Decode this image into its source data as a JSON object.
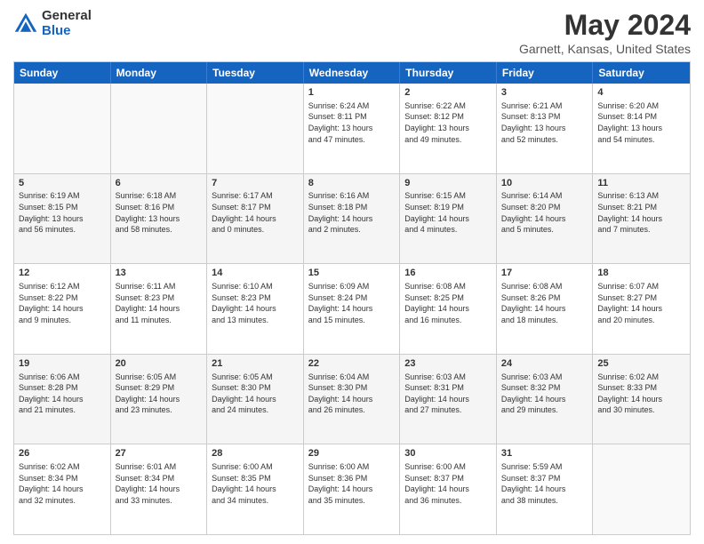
{
  "logo": {
    "general": "General",
    "blue": "Blue"
  },
  "title": "May 2024",
  "subtitle": "Garnett, Kansas, United States",
  "calendar": {
    "headers": [
      "Sunday",
      "Monday",
      "Tuesday",
      "Wednesday",
      "Thursday",
      "Friday",
      "Saturday"
    ],
    "rows": [
      [
        {
          "day": "",
          "text": ""
        },
        {
          "day": "",
          "text": ""
        },
        {
          "day": "",
          "text": ""
        },
        {
          "day": "1",
          "text": "Sunrise: 6:24 AM\nSunset: 8:11 PM\nDaylight: 13 hours\nand 47 minutes."
        },
        {
          "day": "2",
          "text": "Sunrise: 6:22 AM\nSunset: 8:12 PM\nDaylight: 13 hours\nand 49 minutes."
        },
        {
          "day": "3",
          "text": "Sunrise: 6:21 AM\nSunset: 8:13 PM\nDaylight: 13 hours\nand 52 minutes."
        },
        {
          "day": "4",
          "text": "Sunrise: 6:20 AM\nSunset: 8:14 PM\nDaylight: 13 hours\nand 54 minutes."
        }
      ],
      [
        {
          "day": "5",
          "text": "Sunrise: 6:19 AM\nSunset: 8:15 PM\nDaylight: 13 hours\nand 56 minutes."
        },
        {
          "day": "6",
          "text": "Sunrise: 6:18 AM\nSunset: 8:16 PM\nDaylight: 13 hours\nand 58 minutes."
        },
        {
          "day": "7",
          "text": "Sunrise: 6:17 AM\nSunset: 8:17 PM\nDaylight: 14 hours\nand 0 minutes."
        },
        {
          "day": "8",
          "text": "Sunrise: 6:16 AM\nSunset: 8:18 PM\nDaylight: 14 hours\nand 2 minutes."
        },
        {
          "day": "9",
          "text": "Sunrise: 6:15 AM\nSunset: 8:19 PM\nDaylight: 14 hours\nand 4 minutes."
        },
        {
          "day": "10",
          "text": "Sunrise: 6:14 AM\nSunset: 8:20 PM\nDaylight: 14 hours\nand 5 minutes."
        },
        {
          "day": "11",
          "text": "Sunrise: 6:13 AM\nSunset: 8:21 PM\nDaylight: 14 hours\nand 7 minutes."
        }
      ],
      [
        {
          "day": "12",
          "text": "Sunrise: 6:12 AM\nSunset: 8:22 PM\nDaylight: 14 hours\nand 9 minutes."
        },
        {
          "day": "13",
          "text": "Sunrise: 6:11 AM\nSunset: 8:23 PM\nDaylight: 14 hours\nand 11 minutes."
        },
        {
          "day": "14",
          "text": "Sunrise: 6:10 AM\nSunset: 8:23 PM\nDaylight: 14 hours\nand 13 minutes."
        },
        {
          "day": "15",
          "text": "Sunrise: 6:09 AM\nSunset: 8:24 PM\nDaylight: 14 hours\nand 15 minutes."
        },
        {
          "day": "16",
          "text": "Sunrise: 6:08 AM\nSunset: 8:25 PM\nDaylight: 14 hours\nand 16 minutes."
        },
        {
          "day": "17",
          "text": "Sunrise: 6:08 AM\nSunset: 8:26 PM\nDaylight: 14 hours\nand 18 minutes."
        },
        {
          "day": "18",
          "text": "Sunrise: 6:07 AM\nSunset: 8:27 PM\nDaylight: 14 hours\nand 20 minutes."
        }
      ],
      [
        {
          "day": "19",
          "text": "Sunrise: 6:06 AM\nSunset: 8:28 PM\nDaylight: 14 hours\nand 21 minutes."
        },
        {
          "day": "20",
          "text": "Sunrise: 6:05 AM\nSunset: 8:29 PM\nDaylight: 14 hours\nand 23 minutes."
        },
        {
          "day": "21",
          "text": "Sunrise: 6:05 AM\nSunset: 8:30 PM\nDaylight: 14 hours\nand 24 minutes."
        },
        {
          "day": "22",
          "text": "Sunrise: 6:04 AM\nSunset: 8:30 PM\nDaylight: 14 hours\nand 26 minutes."
        },
        {
          "day": "23",
          "text": "Sunrise: 6:03 AM\nSunset: 8:31 PM\nDaylight: 14 hours\nand 27 minutes."
        },
        {
          "day": "24",
          "text": "Sunrise: 6:03 AM\nSunset: 8:32 PM\nDaylight: 14 hours\nand 29 minutes."
        },
        {
          "day": "25",
          "text": "Sunrise: 6:02 AM\nSunset: 8:33 PM\nDaylight: 14 hours\nand 30 minutes."
        }
      ],
      [
        {
          "day": "26",
          "text": "Sunrise: 6:02 AM\nSunset: 8:34 PM\nDaylight: 14 hours\nand 32 minutes."
        },
        {
          "day": "27",
          "text": "Sunrise: 6:01 AM\nSunset: 8:34 PM\nDaylight: 14 hours\nand 33 minutes."
        },
        {
          "day": "28",
          "text": "Sunrise: 6:00 AM\nSunset: 8:35 PM\nDaylight: 14 hours\nand 34 minutes."
        },
        {
          "day": "29",
          "text": "Sunrise: 6:00 AM\nSunset: 8:36 PM\nDaylight: 14 hours\nand 35 minutes."
        },
        {
          "day": "30",
          "text": "Sunrise: 6:00 AM\nSunset: 8:37 PM\nDaylight: 14 hours\nand 36 minutes."
        },
        {
          "day": "31",
          "text": "Sunrise: 5:59 AM\nSunset: 8:37 PM\nDaylight: 14 hours\nand 38 minutes."
        },
        {
          "day": "",
          "text": ""
        }
      ]
    ]
  }
}
